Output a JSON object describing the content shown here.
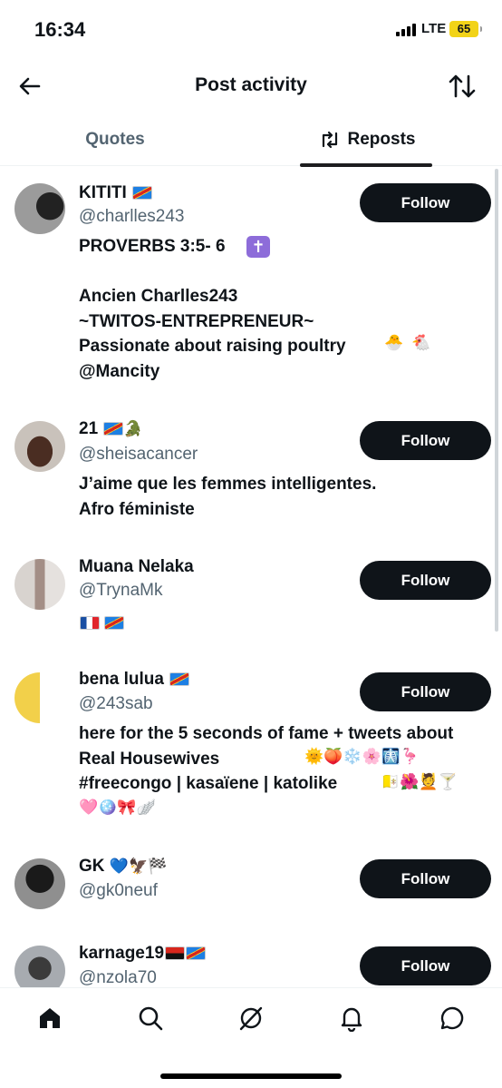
{
  "status_bar": {
    "time": "16:34",
    "network": "LTE",
    "battery": "65"
  },
  "header": {
    "title": "Post activity"
  },
  "tabs": [
    {
      "label": "Quotes",
      "selected": false
    },
    {
      "label": "Reposts",
      "selected": true
    }
  ],
  "follow_label": "Follow",
  "users": [
    {
      "name": "KITITI",
      "handle": "@charlles243",
      "bio": "PROVERBS 3:5- 6\n\nAncien Charlles243\n~TWITOS-ENTREPRENEUR~\nPassionate about raising poultry\n@Mancity",
      "avatar_color": "#6d6d6d"
    },
    {
      "name": "21",
      "handle": "@sheisacancer",
      "bio": "J’aime que les femmes intelligentes.\nAfro féministe",
      "avatar_color": "#5a3b2a"
    },
    {
      "name": "Muana Nelaka",
      "handle": "@TrynaMk",
      "bio": "",
      "avatar_color": "#b9a7a0"
    },
    {
      "name": "bena lulua",
      "handle": "@243sab",
      "bio": "here for the 5 seconds of fame + tweets about Real Housewives\n#freecongo | kasaïene | katolike",
      "avatar_color": "#f2d04a"
    },
    {
      "name": "GK",
      "handle": "@gk0neuf",
      "bio": "",
      "avatar_color": "#2d2d2d"
    },
    {
      "name": "karnage19",
      "handle": "@nzola70",
      "bio": "",
      "avatar_color": "#8b8f95"
    }
  ],
  "bottom_nav": [
    "home-icon",
    "search-icon",
    "grok-icon",
    "notifications-icon",
    "messages-icon"
  ],
  "colors": {
    "text": "#0f1419",
    "secondary": "#536471",
    "button": "#0f1419",
    "battery": "#f2d318"
  }
}
